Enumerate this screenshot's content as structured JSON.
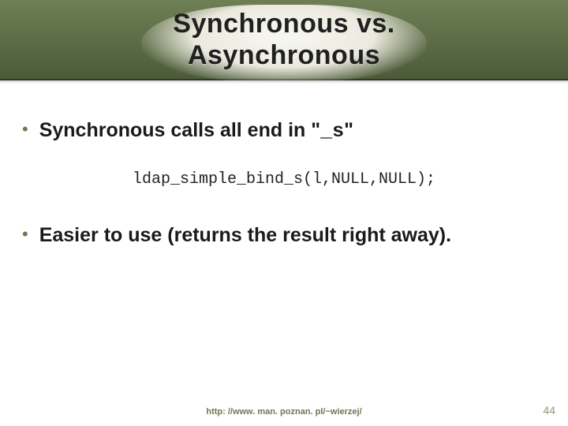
{
  "title_line1": "Synchronous vs.",
  "title_line2": "Asynchronous",
  "bullets": {
    "b1_pre": "Synchronous calls all end in \"",
    "b1_mono": "_s",
    "b1_post": "\"",
    "b2": "Easier to use (returns the result right away)."
  },
  "code_line": "ldap_simple_bind_s(l,NULL,NULL);",
  "footer_url": "http: //www. man. poznan. pl/~wierzej/",
  "page_number": "44"
}
